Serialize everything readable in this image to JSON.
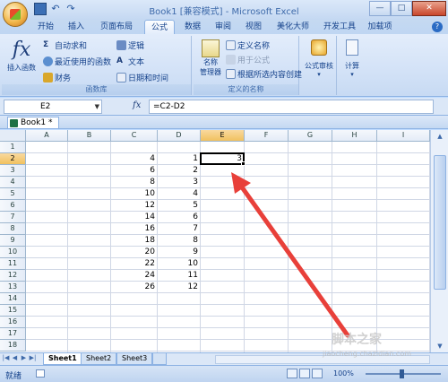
{
  "window": {
    "title": "Book1  [兼容模式]  - Microsoft Excel",
    "minimize": "—",
    "maximize": "□",
    "close": "✕"
  },
  "tabs": [
    "开始",
    "插入",
    "页面布局",
    "公式",
    "数据",
    "审阅",
    "视图",
    "美化大师",
    "开发工具",
    "加载项"
  ],
  "active_tab": "公式",
  "ribbon": {
    "group1": {
      "insert_function": "插入函数",
      "autosum": "自动求和",
      "recent": "最近使用的函数",
      "financial": "财务",
      "logical": "逻辑",
      "text": "文本",
      "datetime": "日期和时间",
      "label": "函数库"
    },
    "group2": {
      "name_manager_line1": "名称",
      "name_manager_line2": "管理器",
      "define_name": "定义名称",
      "use_in_formula": "用于公式",
      "create_from_selection": "根据所选内容创建",
      "label": "定义的名称"
    },
    "group3": {
      "formula_auditing": "公式审核",
      "calculation": "计算"
    }
  },
  "formula_bar": {
    "name_box": "E2",
    "fx": "fx",
    "formula": "=C2-D2"
  },
  "workbook_tab": "Book1 *",
  "columns": [
    "A",
    "B",
    "C",
    "D",
    "E",
    "F",
    "G",
    "H",
    "I"
  ],
  "rows": [
    "1",
    "2",
    "3",
    "4",
    "5",
    "6",
    "7",
    "8",
    "9",
    "10",
    "11",
    "12",
    "13",
    "14",
    "15",
    "16",
    "17",
    "18"
  ],
  "cells": {
    "C": [
      "",
      "4",
      "6",
      "8",
      "10",
      "12",
      "14",
      "16",
      "18",
      "20",
      "22",
      "24",
      "26"
    ],
    "D": [
      "",
      "1",
      "2",
      "3",
      "4",
      "5",
      "6",
      "7",
      "8",
      "9",
      "10",
      "11",
      "12"
    ],
    "E2": "3"
  },
  "active_cell": "E2",
  "sheets": [
    "Sheet1",
    "Sheet2",
    "Sheet3"
  ],
  "active_sheet": "Sheet1",
  "status": {
    "ready": "就绪",
    "zoom": "100%"
  },
  "watermark": {
    "main": "脚本之家",
    "sub": "jiaocheng.chazidian.com"
  },
  "arrow_color": "#e8403a"
}
